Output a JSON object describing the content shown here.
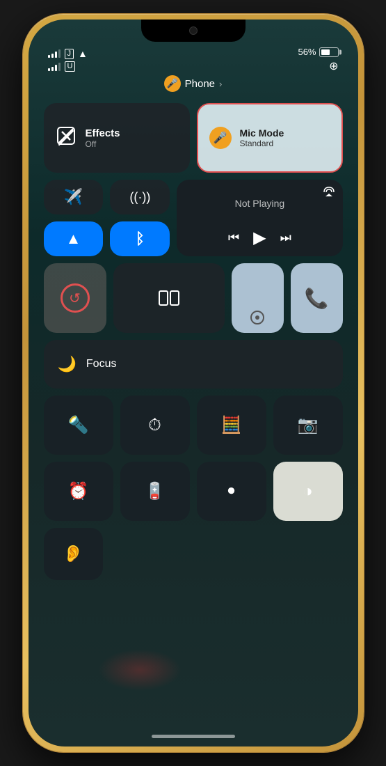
{
  "phone": {
    "notch": "notch",
    "status": {
      "battery_pct": "56%",
      "screen_rotation": "⊕"
    },
    "phone_label": "Phone",
    "chevron": "›",
    "control_center": {
      "effects": {
        "title": "Effects",
        "sub": "Off"
      },
      "mic_mode": {
        "title": "Mic Mode",
        "sub": "Standard"
      },
      "now_playing": {
        "text": "Not Playing"
      },
      "focus": {
        "label": "Focus"
      }
    }
  }
}
